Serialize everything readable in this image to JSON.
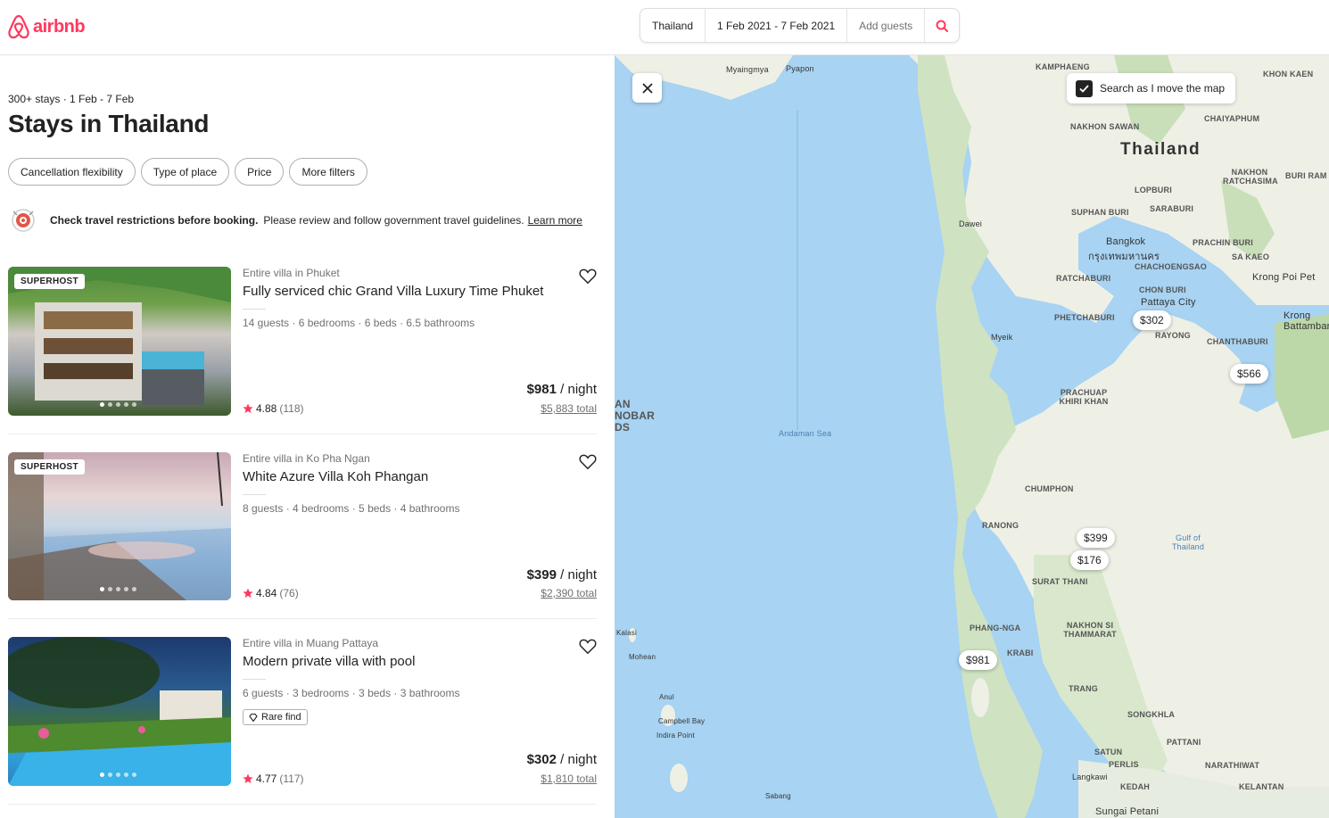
{
  "header": {
    "logo_text": "airbnb",
    "search": {
      "location": "Thailand",
      "dates": "1 Feb 2021 - 7 Feb 2021",
      "guests_placeholder": "Add guests"
    }
  },
  "results": {
    "meta": "300+ stays · 1 Feb - 7 Feb",
    "title": "Stays in Thailand",
    "filters": [
      "Cancellation flexibility",
      "Type of place",
      "Price",
      "More filters"
    ],
    "notice": {
      "bold": "Check travel restrictions before booking.",
      "text": "Please review and follow government travel guidelines.",
      "link": "Learn more"
    }
  },
  "listings": [
    {
      "badge": "SUPERHOST",
      "type": "Entire villa in Phuket",
      "name": "Fully serviced chic Grand Villa Luxury Time Phuket",
      "specs": "14 guests · 6 bedrooms · 6 beds · 6.5 bathrooms",
      "rating": "4.88",
      "reviews": "(118)",
      "price": "$981",
      "per": " / night",
      "total": "$5,883 total"
    },
    {
      "badge": "SUPERHOST",
      "type": "Entire villa in Ko Pha Ngan",
      "name": "White Azure Villa Koh Phangan",
      "specs": "8 guests · 4 bedrooms · 5 beds · 4 bathrooms",
      "rating": "4.84",
      "reviews": "(76)",
      "price": "$399",
      "per": " / night",
      "total": "$2,390 total"
    },
    {
      "badge": "",
      "type": "Entire villa in Muang Pattaya",
      "name": "Modern private villa with pool",
      "specs": "6 guests · 3 bedrooms · 3 beds · 3 bathrooms",
      "tag": "Rare find",
      "rating": "4.77",
      "reviews": "(117)",
      "price": "$302",
      "per": " / night",
      "total": "$1,810 total"
    }
  ],
  "map": {
    "toggle_label": "Search as I move the map",
    "pins": [
      "$302",
      "$566",
      "$399",
      "$176",
      "$981"
    ],
    "labels": {
      "country": "Thailand",
      "bangkok": "Bangkok",
      "bangkok_th": "กรุงเทพมหานคร",
      "pattaya": "Pattaya City",
      "andaman": "Andaman Sea",
      "gulf": "Gulf of Thailand",
      "nakhon_sawan": "NAKHON SAWAN",
      "chaiyaphum": "CHAIYAPHUM",
      "lopburi": "LOPBURI",
      "saraburi": "SARABURI",
      "suphan": "SUPHAN BURI",
      "nakhon_ratchasima": "NAKHON RATCHASIMA",
      "buri_ram": "BURI RAM",
      "prachin": "PRACHIN BURI",
      "sa_kaeo": "SA KAEO",
      "chachoengsao": "CHACHOENGSAO",
      "ratchaburi": "RATCHABURI",
      "chon_buri": "CHON BURI",
      "phetchaburi": "PHETCHABURI",
      "rayong": "RAYONG",
      "chanthaburi": "CHANTHABURI",
      "prachuap": "PRACHUAP KHIRI KHAN",
      "chumphon": "CHUMPHON",
      "ranong": "RANONG",
      "surat": "SURAT THANI",
      "phang_nga": "PHANG-NGA",
      "krabi": "KRABI",
      "nakhon_si": "NAKHON SI THAMMARAT",
      "trang": "TRANG",
      "songkhla": "SONGKHLA",
      "pattani": "PATTANI",
      "satun": "SATUN",
      "narathiwat": "NARATHIWAT",
      "kamphaeng": "KAMPHAENG",
      "khon_kaen": "KHON KAEN",
      "dawei": "Dawei",
      "myeik": "Myeik",
      "kalasi": "Kalasi",
      "mohean": "Mohean",
      "anul": "Anul",
      "campbell": "Campbell Bay",
      "indira": "Indira Point",
      "sabang": "Sabang",
      "kelantan": "KELANTAN",
      "kedah": "KEDAH",
      "perlis": "PERLIS",
      "langkawi": "Langkawi",
      "sungai": "Sungai Petani",
      "krong_poi": "Krong Poi Pet",
      "krong_bat": "Krong Battambang",
      "myaingmya": "Myaingmya",
      "pyapon": "Pyapon",
      "an_nobar": "AN NOBAR DS"
    }
  }
}
